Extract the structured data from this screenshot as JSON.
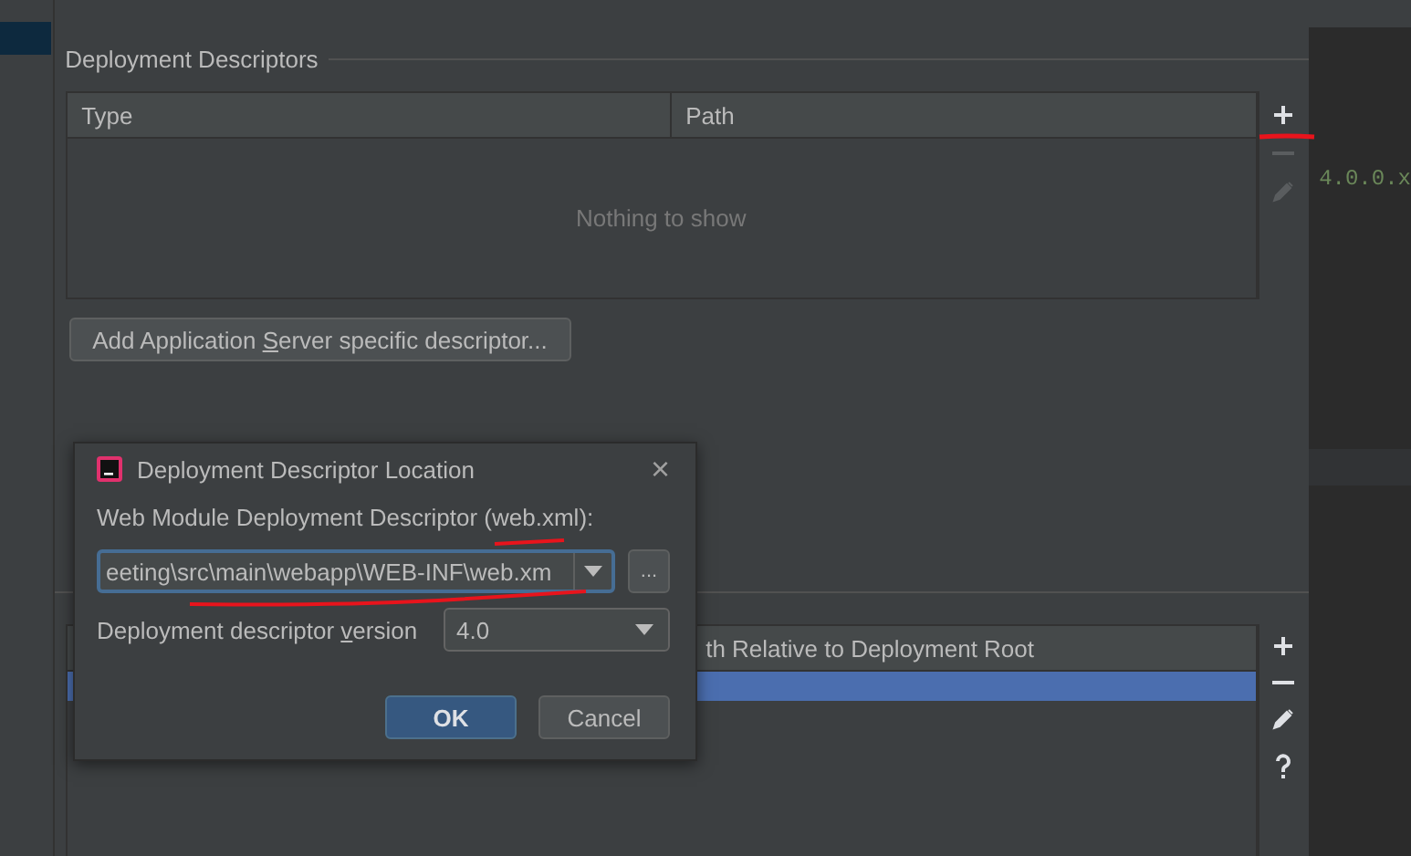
{
  "descriptors": {
    "title": "Deployment Descriptors",
    "columns": [
      "Type",
      "Path"
    ],
    "empty_text": "Nothing to show",
    "tools": [
      {
        "kind": "add",
        "disabled": false
      },
      {
        "kind": "remove",
        "disabled": true
      },
      {
        "kind": "edit",
        "disabled": true
      }
    ],
    "add_button": {
      "before": "Add Application ",
      "mnemonic": "S",
      "after": "erver specific descriptor..."
    }
  },
  "resources": {
    "column_2": "th Relative to Deployment Root",
    "rows": [
      {
        "selected": true
      }
    ],
    "tools": [
      {
        "kind": "add",
        "disabled": false
      },
      {
        "kind": "remove",
        "disabled": false
      },
      {
        "kind": "edit",
        "disabled": false
      },
      {
        "kind": "help",
        "disabled": false
      }
    ]
  },
  "editor": {
    "text": "4.0.0.x"
  },
  "dialog": {
    "title": "Deployment Descriptor Location",
    "close": "×",
    "path_label": "Web Module Deployment Descriptor (web.xml):",
    "path_value": "eeting\\src\\main\\webapp\\WEB-INF\\web.xm",
    "browse": "...",
    "version_label": {
      "before": "Deployment descriptor ",
      "mnemonic": "v",
      "after": "ersion"
    },
    "version_value": "4.0",
    "buttons": [
      {
        "label": "OK",
        "default": true
      },
      {
        "label": "Cancel",
        "default": false
      }
    ]
  }
}
